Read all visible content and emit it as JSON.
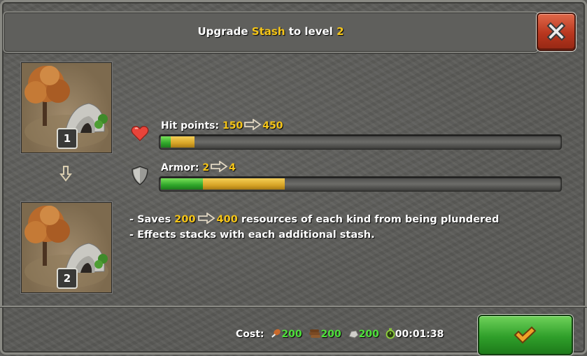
{
  "dialog": {
    "title_prefix": "Upgrade ",
    "building": "Stash",
    "title_mid": " to level ",
    "target_level": "2"
  },
  "levels": {
    "current": "1",
    "next": "2"
  },
  "stats": {
    "hit_points": {
      "label": "Hit points: ",
      "from": "150",
      "to": "450",
      "icon": "heart-icon",
      "current_fraction": 0.024,
      "upgrade_fraction": 0.06
    },
    "armor": {
      "label": "Armor: ",
      "from": "2",
      "to": "4",
      "icon": "shield-icon",
      "current_fraction": 0.105,
      "upgrade_fraction": 0.205
    }
  },
  "description": {
    "line1_prefix": "- Saves ",
    "line1_from": "200",
    "line1_to": "400",
    "line1_suffix": " resources of each kind from being plundered",
    "line2": "- Effects stacks with each additional stash."
  },
  "cost": {
    "label": "Cost:",
    "food": "200",
    "wood": "200",
    "stone": "200",
    "time": "00:01:38"
  },
  "colors": {
    "highlight": "#f5c518",
    "cost_value": "#4ee03a",
    "bar_green": "#2fa62a",
    "bar_yellow": "#d8a527"
  }
}
